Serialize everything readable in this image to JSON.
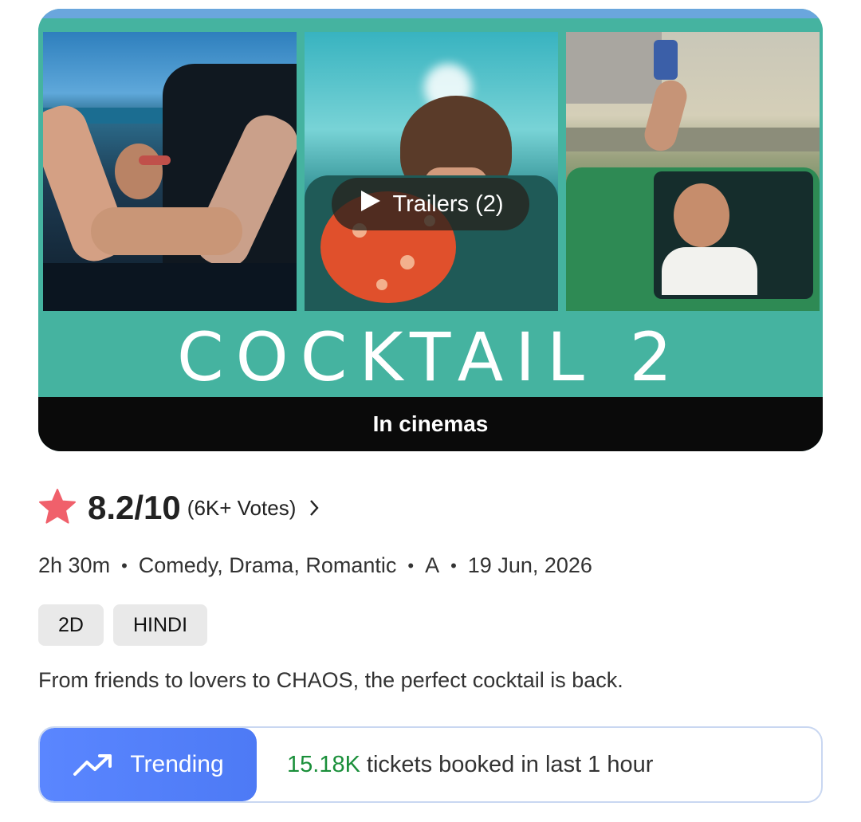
{
  "banner": {
    "poster_title": "COCKTAIL 2",
    "trailer_label": "Trailers (2)",
    "status": "In cinemas"
  },
  "rating": {
    "score": "8.2/10",
    "votes": "(6K+ Votes)",
    "star_color": "#f0606b"
  },
  "meta": {
    "duration": "2h 30m",
    "genres": "Comedy, Drama, Romantic",
    "certificate": "A",
    "release_date": "19 Jun, 2026"
  },
  "tags": [
    "2D",
    "HINDI"
  ],
  "tagline": "From friends to lovers to CHAOS, the perfect cocktail is back.",
  "trending": {
    "label": "Trending",
    "count": "15.18K",
    "text": "tickets booked in last 1 hour",
    "accent": "#5a86ff",
    "count_color": "#1a8f3a"
  },
  "icons": [
    "play-icon",
    "star-icon",
    "chevron-right-icon",
    "trending-up-icon"
  ]
}
